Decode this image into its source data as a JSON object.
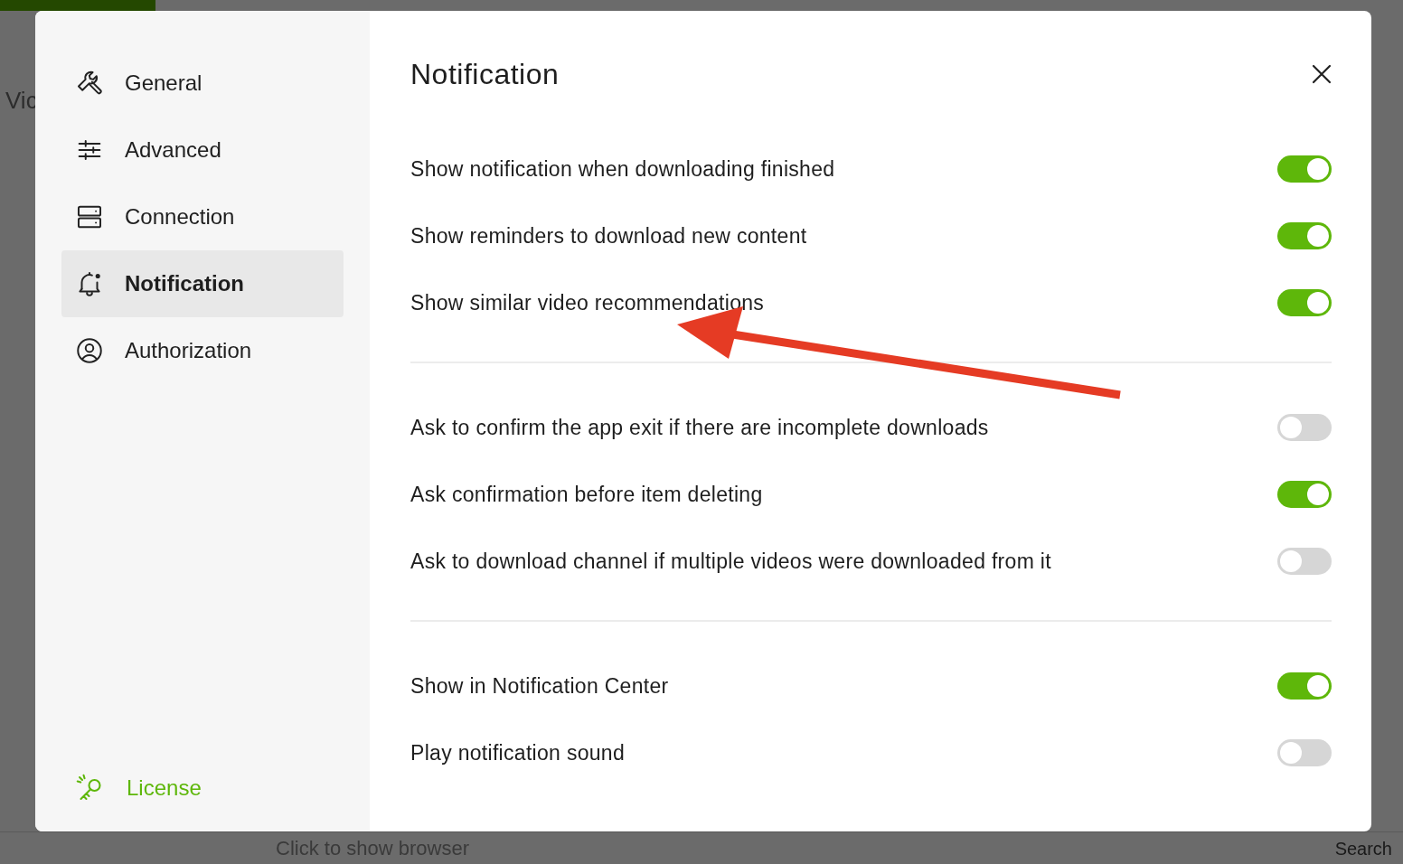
{
  "background": {
    "heading": "Vic",
    "browser_placeholder": "Click to show browser",
    "search_label": "Search"
  },
  "sidebar": {
    "items": [
      {
        "label": "General",
        "kind": "general",
        "selected": false
      },
      {
        "label": "Advanced",
        "kind": "advanced",
        "selected": false
      },
      {
        "label": "Connection",
        "kind": "connection",
        "selected": false
      },
      {
        "label": "Notification",
        "kind": "notification",
        "selected": true
      },
      {
        "label": "Authorization",
        "kind": "authorization",
        "selected": false
      }
    ],
    "license": "License"
  },
  "dialog": {
    "title": "Notification",
    "groups": [
      [
        {
          "label": "Show notification when downloading finished",
          "on": true
        },
        {
          "label": "Show reminders to download new content",
          "on": true
        },
        {
          "label": "Show similar video recommendations",
          "on": true
        }
      ],
      [
        {
          "label": "Ask to confirm the app exit if there are incomplete downloads",
          "on": false
        },
        {
          "label": "Ask confirmation before item deleting",
          "on": true
        },
        {
          "label": "Ask to download channel if multiple videos were downloaded from it",
          "on": false
        }
      ],
      [
        {
          "label": "Show in Notification Center",
          "on": true
        },
        {
          "label": "Play notification sound",
          "on": false
        }
      ]
    ]
  }
}
